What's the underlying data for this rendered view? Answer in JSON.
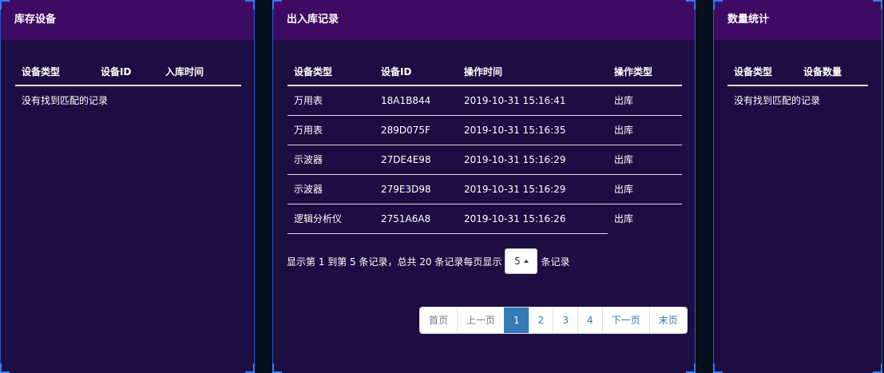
{
  "inventory": {
    "title": "库存设备",
    "columns": [
      "设备类型",
      "设备ID",
      "入库时间"
    ],
    "empty_text": "没有找到匹配的记录"
  },
  "records": {
    "title": "出入库记录",
    "columns": [
      "设备类型",
      "设备ID",
      "操作时间",
      "操作类型"
    ],
    "rows": [
      [
        "万用表",
        "18A1B844",
        "2019-10-31 15:16:41",
        "出库"
      ],
      [
        "万用表",
        "289D075F",
        "2019-10-31 15:16:35",
        "出库"
      ],
      [
        "示波器",
        "27DE4E98",
        "2019-10-31 15:16:29",
        "出库"
      ],
      [
        "示波器",
        "279E3D98",
        "2019-10-31 15:16:29",
        "出库"
      ],
      [
        "逻辑分析仪",
        "2751A6A8",
        "2019-10-31 15:16:26",
        "出库"
      ]
    ],
    "pager": {
      "info_prefix": "显示第 1 到第 5 条记录，总共 20 条记录每页显示",
      "page_size": "5",
      "info_suffix": "条记录",
      "first": "首页",
      "prev": "上一页",
      "pages": [
        "1",
        "2",
        "3",
        "4"
      ],
      "next": "下一页",
      "last": "末页"
    }
  },
  "stats": {
    "title": "数量统计",
    "columns": [
      "设备类型",
      "设备数量"
    ],
    "empty_text": "没有找到匹配的记录"
  }
}
